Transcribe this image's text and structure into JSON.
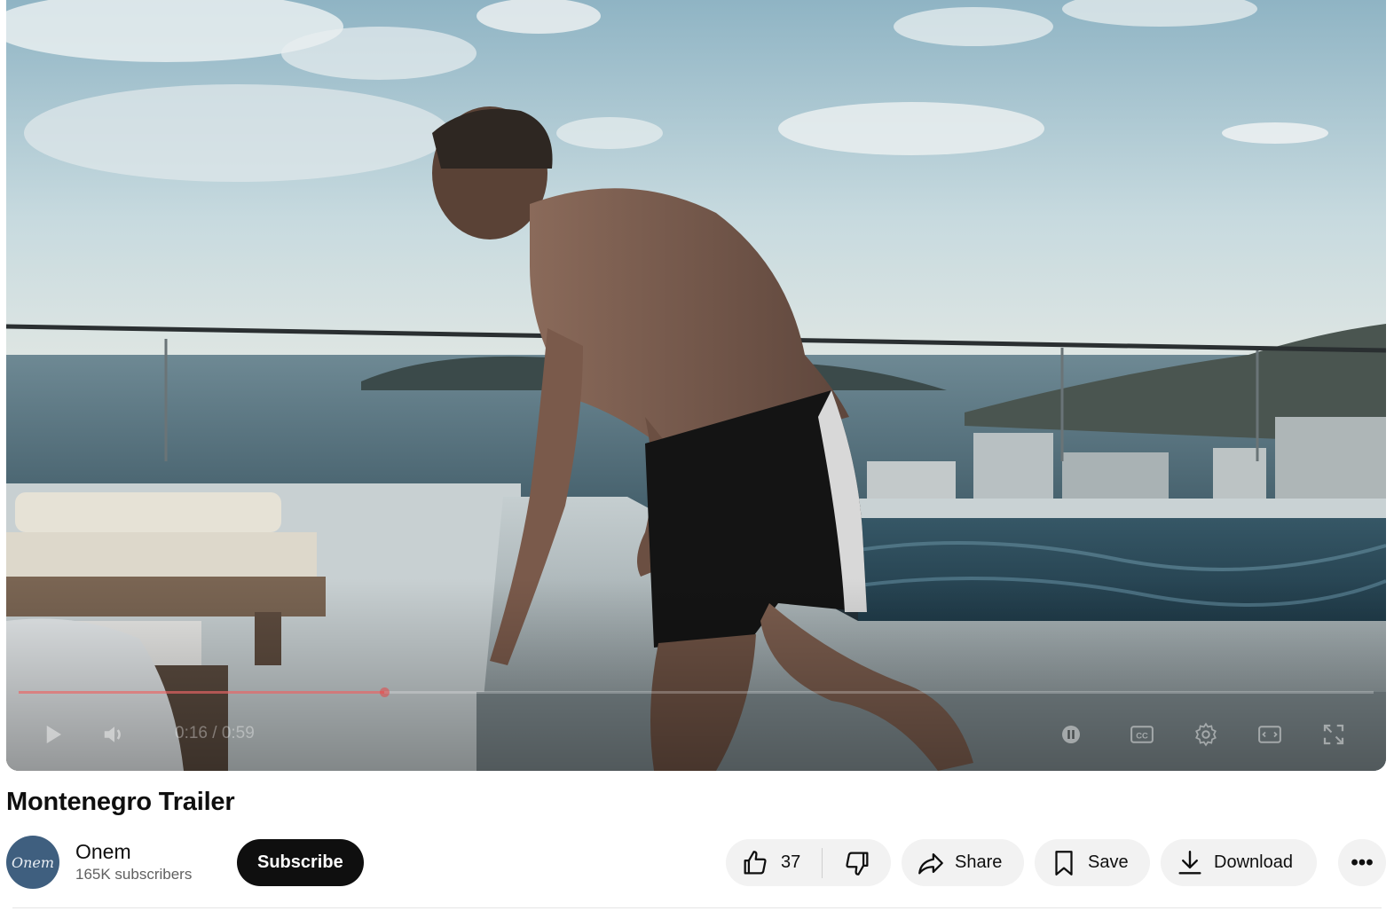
{
  "player": {
    "current_time": "0:16",
    "duration": "0:59",
    "time_separator": " / ",
    "progress_fraction": 0.27,
    "accent_color": "#e64646",
    "controls": {
      "play_icon": "play-icon",
      "volume_icon": "volume-icon",
      "pause_toggle_icon": "autoplay-toggle-icon",
      "captions_icon": "cc-icon",
      "settings_icon": "gear-icon",
      "theater_icon": "theater-mode-icon",
      "fullscreen_icon": "fullscreen-icon"
    }
  },
  "video": {
    "title": "Montenegro Trailer"
  },
  "channel": {
    "name": "Onem",
    "avatar_text": "Onem",
    "subscribers": "165K subscribers",
    "subscribe_label": "Subscribe"
  },
  "actions": {
    "like_count": "37",
    "share_label": "Share",
    "save_label": "Save",
    "download_label": "Download",
    "more_label": "•••"
  }
}
